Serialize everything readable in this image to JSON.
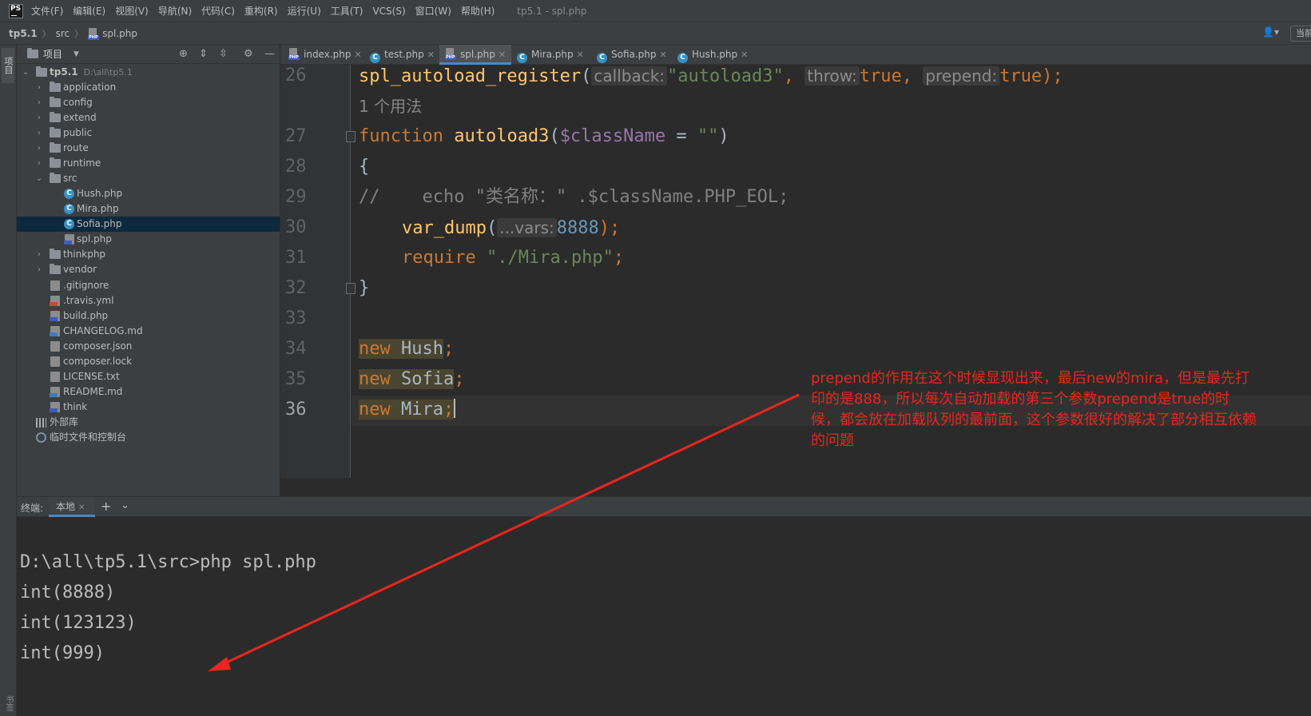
{
  "app": {
    "logo": "PS",
    "window_title": "tp5.1 - spl.php",
    "menu": [
      "文件(F)",
      "编辑(E)",
      "视图(V)",
      "导航(N)",
      "代码(C)",
      "重构(R)",
      "运行(U)",
      "工具(T)",
      "VCS(S)",
      "窗口(W)",
      "帮助(H)"
    ]
  },
  "breadcrumb": {
    "project": "tp5.1",
    "folder": "src",
    "file": "spl.php",
    "current_button": "当前"
  },
  "left_strip": {
    "project_label": "项目",
    "bottom_label": "书签"
  },
  "project_panel": {
    "title": "项目",
    "root": {
      "name": "tp5.1",
      "path": "D:\\all\\tp5.1"
    },
    "folders_top": [
      "application",
      "config",
      "extend",
      "public",
      "route",
      "runtime"
    ],
    "src_folder": "src",
    "src_files": [
      "Hush.php",
      "Mira.php",
      "Sofia.php",
      "spl.php"
    ],
    "folders_bottom": [
      "thinkphp",
      "vendor"
    ],
    "root_files": [
      ".gitignore",
      ".travis.yml",
      "build.php",
      "CHANGELOG.md",
      "composer.json",
      "composer.lock",
      "LICENSE.txt",
      "README.md",
      "think"
    ],
    "external_libs": "外部库",
    "scratches": "临时文件和控制台"
  },
  "tabs": [
    "index.php",
    "test.php",
    "spl.php",
    "Mira.php",
    "Sofia.php",
    "Hush.php"
  ],
  "editor": {
    "line_numbers": [
      "26",
      "27",
      "28",
      "29",
      "30",
      "31",
      "32",
      "33",
      "34",
      "35",
      "36"
    ],
    "line26": {
      "fn": "spl_autoload_register",
      "open": "(",
      "hint_callback": "callback:",
      "str_callback": "\"autoload3\"",
      "comma1": ", ",
      "hint_throw": "throw:",
      "val_throw": "true",
      "comma2": ", ",
      "hint_prepend": "prepend:",
      "val_prepend": "true",
      "close": ");"
    },
    "usage_hint": "1 个用法",
    "line27": {
      "kw": "function",
      "fn": "autoload3",
      "open": "(",
      "var": "$className",
      "eq": " = ",
      "str": "\"\"",
      "close": ")"
    },
    "line28": "{",
    "line29": "//    echo \"类名称：\" .$className.PHP_EOL;",
    "line30": {
      "fn": "var_dump",
      "open": "(",
      "hint": "...vars:",
      "num": "8888",
      "close": ");"
    },
    "line31": {
      "kw": "require",
      "str": "\"./Mira.php\"",
      "semi": ";"
    },
    "line32": "}",
    "line34": {
      "kw": "new",
      "cls": "Hush",
      "semi": ";"
    },
    "line35": {
      "kw": "new",
      "cls": "Sofia",
      "semi": ";"
    },
    "line36": {
      "kw": "new",
      "cls": "Mira",
      "semi": ";"
    }
  },
  "annotation": "prepend的作用在这个时候显现出来，最后new的mira，但是最先打印的是888，所以每次自动加载的第三个参数prepend是true的时候，都会放在加载队列的最前面，这个参数很好的解决了部分相互依赖的问题",
  "terminal": {
    "label": "终端:",
    "tab": "本地",
    "lines": [
      "D:\\all\\tp5.1\\src>php spl.php",
      "int(8888)",
      "int(123123)",
      "int(999)"
    ]
  },
  "colors": {
    "annotation": "#e8261d",
    "keyword": "#cc7832",
    "function": "#ffc66d",
    "string": "#6a8759",
    "variable": "#9876aa",
    "number": "#6897bb",
    "selection": "#0d293e",
    "tab_underline": "#4a88c7"
  }
}
